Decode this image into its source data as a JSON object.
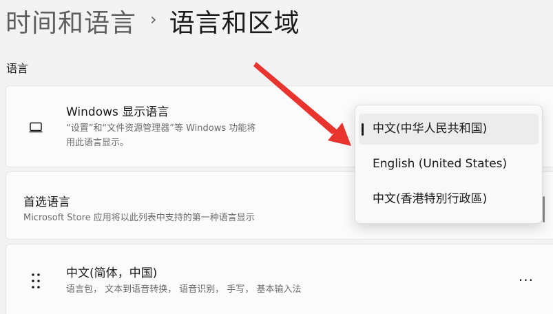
{
  "header": {
    "parent": "时间和语言",
    "separator": "›",
    "current": "语言和区域"
  },
  "section": {
    "language_label": "语言"
  },
  "display_language": {
    "icon": "monitor-icon",
    "title": "Windows 显示语言",
    "desc_line1": "“设置”和“文件资源管理器”等 Windows 功能将",
    "desc_line2": "用此语言显示。"
  },
  "preferred_language": {
    "title": "首选语言",
    "desc": "Microsoft Store 应用将以此列表中支持的第一种语言显示"
  },
  "language_entry": {
    "icon": "drag-grip-icon",
    "title": "中文(简体，中国)",
    "desc": "语言包， 文本到语音转换， 语音识别， 手写， 基本输入法",
    "more": "···"
  },
  "dropdown": {
    "options": [
      {
        "label": "中文(中华人民共和国)",
        "selected": true
      },
      {
        "label": "English (United States)",
        "selected": false
      },
      {
        "label": "中文(香港特別行政區)",
        "selected": false
      }
    ]
  },
  "colors": {
    "background": "#f3f3f3",
    "card": "#fbfbfb",
    "annotation_arrow": "#e8332e"
  }
}
